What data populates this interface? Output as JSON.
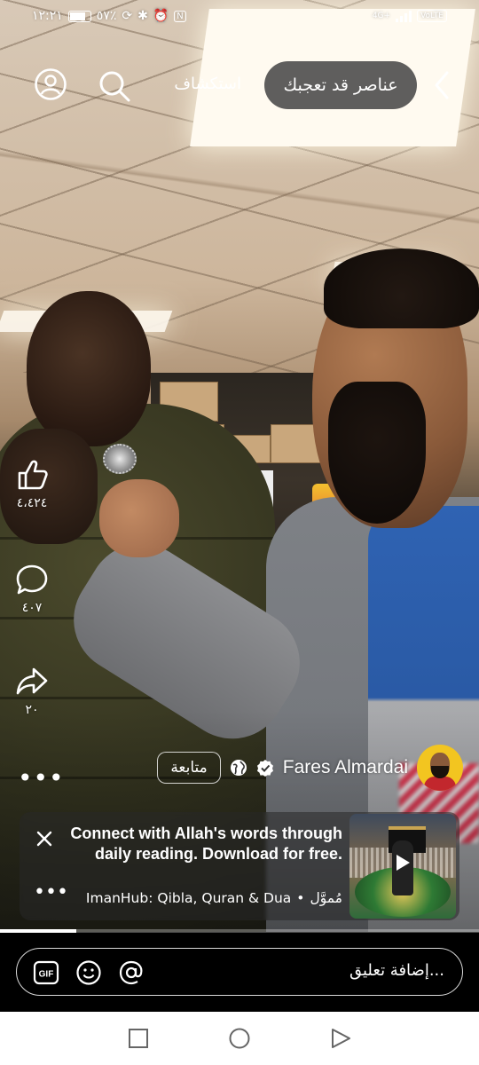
{
  "status_bar": {
    "time": "١٢:٢١",
    "battery": "٥٧٪",
    "network": "4G+",
    "volte": "VoLTE"
  },
  "top_bar": {
    "suggested_label": "عناصر قد تعجبك",
    "explore_label": "استكشاف",
    "icons": [
      "back-chevron-icon",
      "search-icon",
      "profile-icon"
    ]
  },
  "actions": {
    "likes": "٤،٤٢٤",
    "comments": "٤٠٧",
    "shares": "٢٠",
    "more": "•••"
  },
  "author": {
    "name": "Fares Almardai",
    "follow_label": "متابعة"
  },
  "ad": {
    "text": "Connect with Allah's words through daily reading. Download for free.",
    "app_name": "ImanHub: Qibla, Quran & Dua",
    "sponsored": "مُموَّل",
    "separator": "•",
    "more": "•••"
  },
  "video": {
    "progress_fraction": 0.16
  },
  "comment_bar": {
    "placeholder": "إضافة تعليق...",
    "gif_label": "GIF",
    "icons": [
      "gif-icon",
      "emoji-icon",
      "mention-icon"
    ]
  },
  "nav_bar": {
    "icons": [
      "recents-square-icon",
      "home-circle-icon",
      "back-triangle-icon"
    ]
  },
  "colors": {
    "pill_bg": "#3c3c3c",
    "avatar_bg": "#f2c520",
    "background": "#000000",
    "nav_bg": "#ffffff"
  }
}
